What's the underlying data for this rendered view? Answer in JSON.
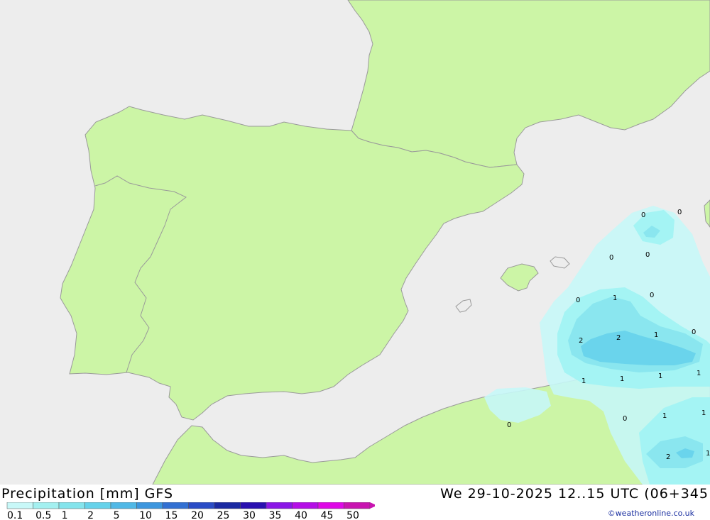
{
  "header": {
    "title": "Precipitation [mm] GFS",
    "datetime": "We 29-10-2025 12..15 UTC (06+345",
    "credit": "©weatheronline.co.uk"
  },
  "colors": {
    "sea": "#ededed",
    "land": "#ccf5a6",
    "border": "#9a9a9a",
    "precip_0_1": "#c6f7f7",
    "precip_0_5": "#a4f4f4",
    "precip_1": "#8ae6ef",
    "precip_2": "#6ad4ec"
  },
  "legend": {
    "labels": [
      "0.1",
      "0.5",
      "1",
      "2",
      "5",
      "10",
      "15",
      "20",
      "25",
      "30",
      "35",
      "40",
      "45",
      "50"
    ],
    "colors": [
      "#c8f8f8",
      "#a4f0f0",
      "#84e4ec",
      "#66d2ea",
      "#50b8e6",
      "#3c96de",
      "#3270d2",
      "#2a4cc6",
      "#1a2aa2",
      "#2a10b0",
      "#8a16e6",
      "#b40ee6",
      "#de08e6",
      "#c814b0"
    ]
  },
  "contour_labels": [
    "0",
    "0",
    "0",
    "0",
    "0",
    "1",
    "0",
    "2",
    "2",
    "1",
    "0",
    "1",
    "1",
    "1",
    "1",
    "0",
    "0",
    "1",
    "1",
    "2",
    "1"
  ]
}
